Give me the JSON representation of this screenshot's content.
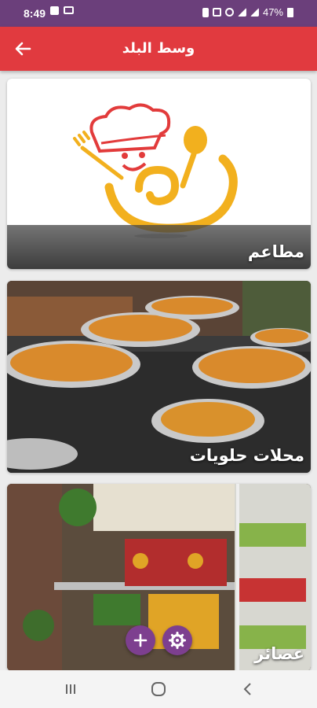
{
  "status_bar": {
    "time": "8:49",
    "battery": "47%"
  },
  "app_bar": {
    "title": "وسط البلد",
    "back_icon": "arrow-left-icon"
  },
  "categories": [
    {
      "label": "مطاعم",
      "image": "restaurant-chef-logo"
    },
    {
      "label": "محلات حلويات",
      "image": "knafeh-trays-photo"
    },
    {
      "label": "عصائر",
      "image": "juice-fruit-shop-photo"
    }
  ],
  "fabs": {
    "add_icon": "plus-icon",
    "settings_icon": "gear-icon"
  },
  "colors": {
    "status_bar": "#6b3f7b",
    "app_bar": "#e13a3f",
    "fab": "#7d3f8f"
  }
}
